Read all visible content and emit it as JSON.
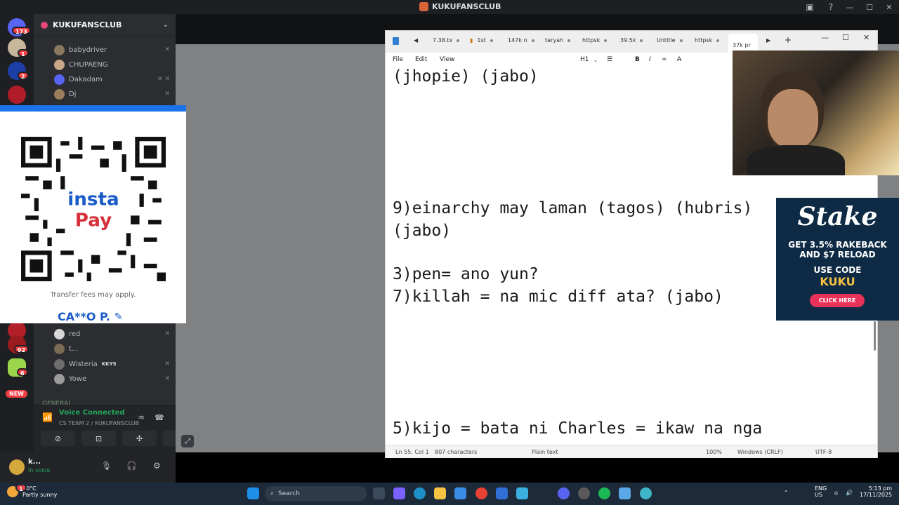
{
  "window": {
    "title": "KUKUFANSCLUB"
  },
  "server_rail": {
    "badges": {
      "home": "173",
      "s1": "1",
      "s2": "2",
      "s3": "92",
      "s4": "6"
    },
    "new_label": "NEW"
  },
  "sidebar": {
    "server_name": "KUKUFANSCLUB",
    "members_top": [
      {
        "name": "babydriver"
      },
      {
        "name": "CHUPAENG"
      },
      {
        "name": "Dakadam"
      },
      {
        "name": "Dj"
      }
    ],
    "members_bottom": [
      {
        "name": "red"
      },
      {
        "name": "t..."
      },
      {
        "name": "Wisteria",
        "tag": "KKYS"
      },
      {
        "name": "Yowe"
      }
    ],
    "category": "GENERAL"
  },
  "voice": {
    "status": "Voice Connected",
    "channel": "CS TEAM 2 / KUKUFANSCLUB"
  },
  "user": {
    "name": "k...",
    "status": "In voice"
  },
  "qr_overlay": {
    "logo_line1": "insta",
    "logo_line2": "Pay",
    "note": "Transfer fees may apply.",
    "account_name": "CA**O P."
  },
  "notepad": {
    "tabs": [
      {
        "label": "7.38.tx"
      },
      {
        "label": "1st"
      },
      {
        "label": "147k n"
      },
      {
        "label": "taryah"
      },
      {
        "label": "httpsk"
      },
      {
        "label": "39.5k"
      },
      {
        "label": "Untitle"
      },
      {
        "label": "httpsk"
      },
      {
        "label": "37k pr"
      }
    ],
    "menu": {
      "file": "File",
      "edit": "Edit",
      "view": "View",
      "heading": "H1"
    },
    "lines": [
      "(jhopie) (jabo)",
      "9)einarchy may laman (tagos) (hubris)",
      "(jabo)",
      "3)pen= ano yun?",
      "7)killah = na mic diff ata? (jabo)",
      "5)kijo = bata ni Charles = ikaw na nga"
    ],
    "status": {
      "position": "Ln 55, Col 1",
      "chars": "807 characters",
      "format": "Plain text",
      "zoom": "100%",
      "eol": "Windows (CRLF)",
      "encoding": "UTF-8"
    }
  },
  "stake_ad": {
    "logo": "Stake",
    "line1": "GET 3.5% RAKEBACK",
    "line2": "AND $7 RELOAD",
    "line3": "USE CODE",
    "code": "KUKU",
    "button": "CLICK HERE"
  },
  "taskbar": {
    "temp": "30°C",
    "weather": "Partly sunny",
    "search_placeholder": "Search",
    "lang": "ENG",
    "region": "US",
    "time": "5:13 pm",
    "date": "17/11/2025",
    "weather_badge": "1"
  },
  "colors": {
    "discord_bg": "#1e1f22",
    "sidebar_bg": "#2b2d31",
    "voice_green": "#23a55a",
    "instapay_blue": "#1a5bc8",
    "stake_bg": "#0e2a44",
    "taskbar_bg": "#1c2a3a"
  }
}
